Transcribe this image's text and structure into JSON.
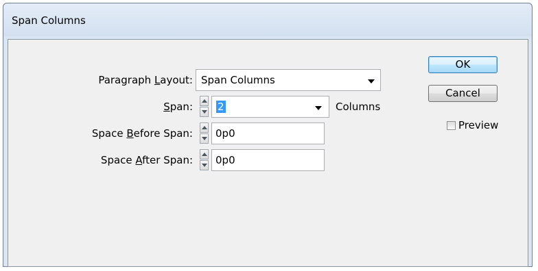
{
  "dialog": {
    "title": "Span Columns"
  },
  "form": {
    "paragraph_layout": {
      "label_pre": "Paragraph ",
      "label_u": "L",
      "label_post": "ayout:",
      "value": "Span Columns"
    },
    "span": {
      "label_pre": "",
      "label_u": "S",
      "label_post": "pan:",
      "value": "2",
      "suffix": "Columns"
    },
    "space_before": {
      "label_pre": "Space ",
      "label_u": "B",
      "label_post": "efore Span:",
      "value": "0p0"
    },
    "space_after": {
      "label_pre": "Space ",
      "label_u": "A",
      "label_post": "fter Span:",
      "value": "0p0"
    }
  },
  "buttons": {
    "ok": "OK",
    "cancel": "Cancel"
  },
  "preview": {
    "label": "Preview",
    "checked": false
  }
}
